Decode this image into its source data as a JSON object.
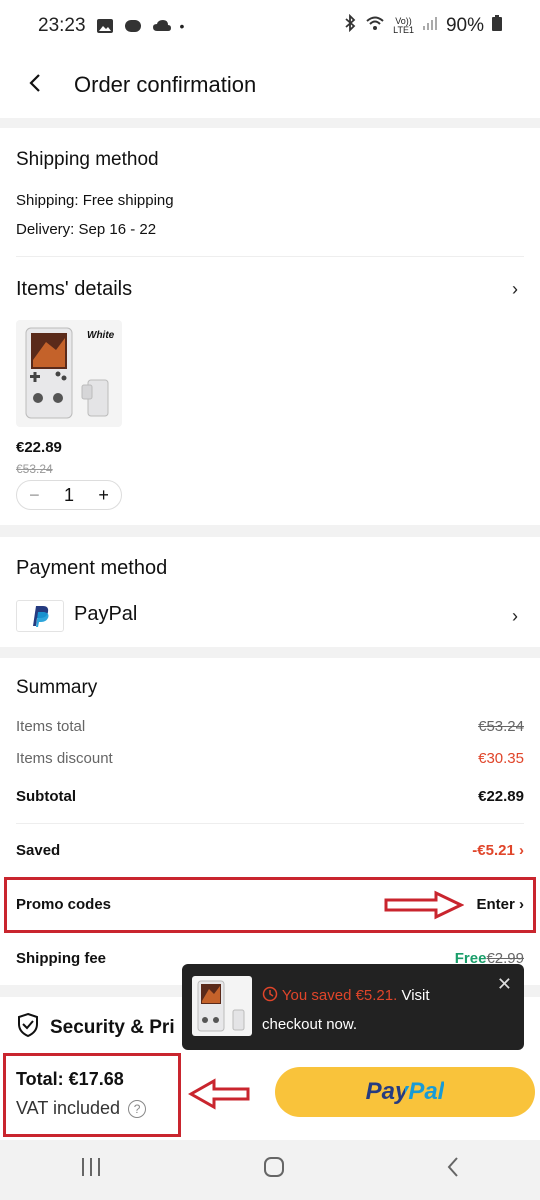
{
  "status_bar": {
    "time": "23:23",
    "network": "LTE1",
    "volte": "Vo))",
    "battery": "90%",
    "icons": [
      "image-icon",
      "app-badge-icon",
      "cloud-icon",
      "dot-icon",
      "bluetooth-icon",
      "wifi-icon",
      "signal-icon",
      "battery-icon"
    ]
  },
  "header": {
    "title": "Order confirmation",
    "back_icon": "chevron-left-icon"
  },
  "shipping": {
    "title": "Shipping method",
    "shipping_line": "Shipping: Free shipping",
    "delivery_line": "Delivery: Sep 16 - 22"
  },
  "items": {
    "title": "Items' details",
    "product_label": "White",
    "price": "€22.89",
    "old_price": "€53.24",
    "quantity": "1",
    "minus": "−",
    "plus": "+"
  },
  "payment": {
    "title": "Payment method",
    "method": "PayPal"
  },
  "summary": {
    "title": "Summary",
    "items_total_label": "Items total",
    "items_total_value": "€53.24",
    "items_discount_label": "Items discount",
    "items_discount_value": "€30.35",
    "subtotal_label": "Subtotal",
    "subtotal_value": "€22.89",
    "saved_label": "Saved",
    "saved_value": "-€5.21",
    "promo_label": "Promo codes",
    "promo_value": "Enter",
    "shipping_fee_label": "Shipping fee",
    "shipping_fee_free": "Free",
    "shipping_fee_old": "€2.99"
  },
  "security": {
    "title": "Security & Pri"
  },
  "popup": {
    "saved_text": "You saved €5.21.",
    "rest_text": " Visit checkout now."
  },
  "bottom": {
    "total_label": "Total:",
    "total_value": "€17.68",
    "vat_text": "VAT included",
    "paypal_button": "PayPal"
  },
  "colors": {
    "accent_red": "#e0452a",
    "annotation_red": "#c9252e",
    "paypal_yellow": "#f9c33b",
    "paypal_dark_blue": "#253b80",
    "paypal_light_blue": "#179bd7",
    "free_green": "#1a9e6a"
  }
}
